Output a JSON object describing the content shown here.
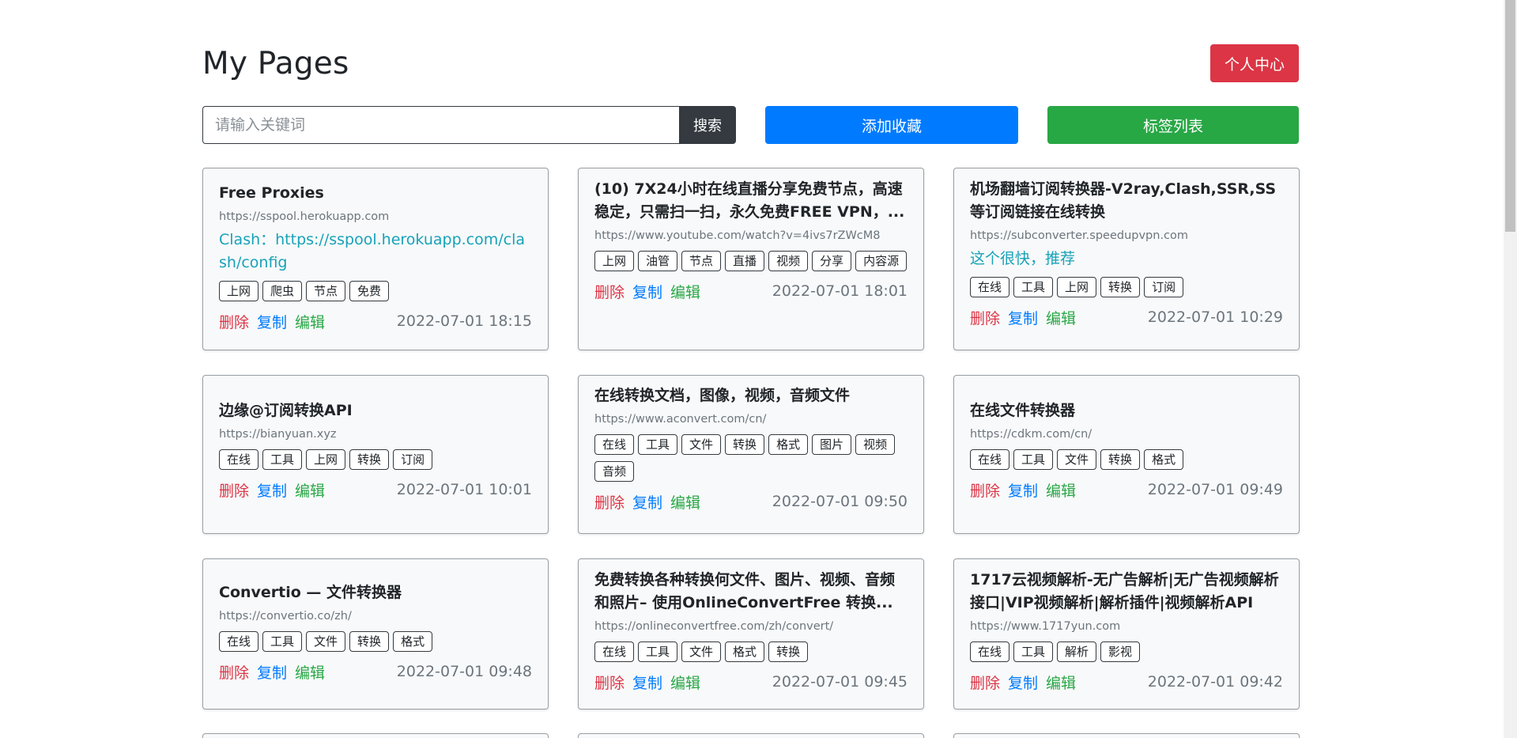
{
  "header": {
    "title": "My Pages",
    "profile_label": "个人中心"
  },
  "toolbar": {
    "search_placeholder": "请输入关键词",
    "search_label": "搜索",
    "add_label": "添加收藏",
    "tags_label": "标签列表"
  },
  "actions": {
    "delete": "删除",
    "copy": "复制",
    "edit": "编辑"
  },
  "colors": {
    "delete": "#dc3545",
    "copy": "#007bff",
    "edit": "#28a745",
    "description": "#17a2b8"
  },
  "cards": [
    {
      "title": "Free Proxies",
      "url": "https://sspool.herokuapp.com",
      "description": "Clash：https://sspool.herokuapp.com/clash/config",
      "tags": [
        "上网",
        "爬虫",
        "节点",
        "免费"
      ],
      "timestamp": "2022-07-01 18:15"
    },
    {
      "title": "(10) 7X24小时在线直播分享免费节点，高速稳定，只需扫一扫，永久免费FREE VPN，...",
      "url": "https://www.youtube.com/watch?v=4ivs7rZWcM8",
      "description": "",
      "tags": [
        "上网",
        "油管",
        "节点",
        "直播",
        "视频",
        "分享",
        "内容源"
      ],
      "timestamp": "2022-07-01 18:01"
    },
    {
      "title": "机场翻墙订阅转换器-V2ray,Clash,SSR,SS等订阅链接在线转换",
      "url": "https://subconverter.speedupvpn.com",
      "description": "这个很快，推荐",
      "tags": [
        "在线",
        "工具",
        "上网",
        "转换",
        "订阅"
      ],
      "timestamp": "2022-07-01 10:29"
    },
    {
      "title": "边缘@订阅转换API",
      "url": "https://bianyuan.xyz",
      "description": "",
      "tags": [
        "在线",
        "工具",
        "上网",
        "转换",
        "订阅"
      ],
      "timestamp": "2022-07-01 10:01"
    },
    {
      "title": "在线转换文档，图像，视频，音频文件",
      "url": "https://www.aconvert.com/cn/",
      "description": "",
      "tags": [
        "在线",
        "工具",
        "文件",
        "转换",
        "格式",
        "图片",
        "视频",
        "音频"
      ],
      "timestamp": "2022-07-01 09:50"
    },
    {
      "title": "在线文件转换器",
      "url": "https://cdkm.com/cn/",
      "description": "",
      "tags": [
        "在线",
        "工具",
        "文件",
        "转换",
        "格式"
      ],
      "timestamp": "2022-07-01 09:49"
    },
    {
      "title": "Convertio — 文件转换器",
      "url": "https://convertio.co/zh/",
      "description": "",
      "tags": [
        "在线",
        "工具",
        "文件",
        "转换",
        "格式"
      ],
      "timestamp": "2022-07-01 09:48"
    },
    {
      "title": "免费转换各种转换何文件、图片、视频、音频和照片– 使用OnlineConvertFree 转换...",
      "url": "https://onlineconvertfree.com/zh/convert/",
      "description": "",
      "tags": [
        "在线",
        "工具",
        "文件",
        "格式",
        "转换"
      ],
      "timestamp": "2022-07-01 09:45"
    },
    {
      "title": "1717云视频解析-无广告解析|无广告视频解析接口|VIP视频解析|解析插件|视频解析API",
      "url": "https://www.1717yun.com",
      "description": "",
      "tags": [
        "在线",
        "工具",
        "解析",
        "影视"
      ],
      "timestamp": "2022-07-01 09:42"
    }
  ]
}
